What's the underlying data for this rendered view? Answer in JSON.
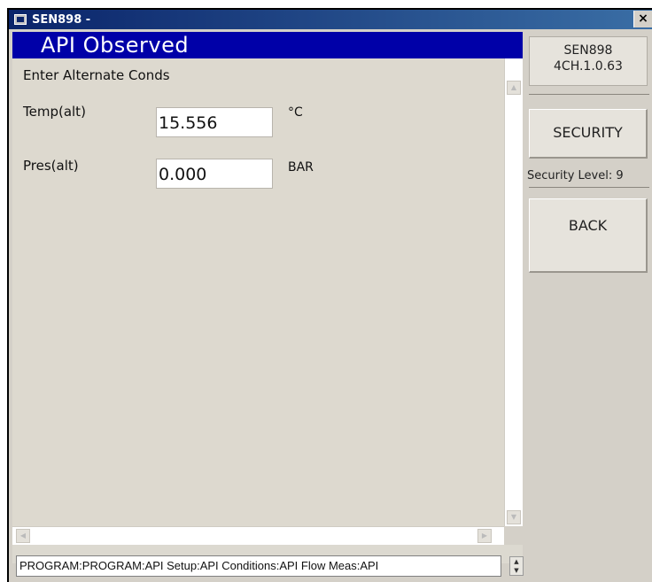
{
  "window": {
    "title": "SEN898 -",
    "close_glyph": "×"
  },
  "header": {
    "title": "API Observed"
  },
  "form": {
    "subtitle": "Enter Alternate Conds",
    "fields": [
      {
        "label": "Temp(alt)",
        "value": "15.556",
        "unit": "°C"
      },
      {
        "label": "Pres(alt)",
        "value": "0.000",
        "unit": "BAR"
      }
    ]
  },
  "status_bar": {
    "path": "PROGRAM:PROGRAM:API Setup:API Conditions:API Flow Meas:API"
  },
  "side_panel": {
    "device_name": "SEN898",
    "firmware": "4CH.1.0.63",
    "security_button": "SECURITY",
    "security_level": "Security Level: 9",
    "back_button": "BACK"
  },
  "colors": {
    "header_blue": "#0000a8",
    "titlebar_blue": "#0a246a",
    "panel_gray": "#d4d0c8"
  }
}
